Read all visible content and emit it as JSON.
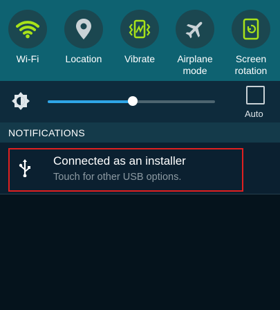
{
  "quick_settings": [
    {
      "label": "Wi-Fi",
      "icon": "wifi-icon",
      "active": true
    },
    {
      "label": "Location",
      "icon": "location-icon",
      "active": false
    },
    {
      "label": "Vibrate",
      "icon": "vibrate-icon",
      "active": true
    },
    {
      "label": "Airplane\nmode",
      "icon": "airplane-icon",
      "active": false
    },
    {
      "label": "Screen\nrotation",
      "icon": "screen-rotation-icon",
      "active": true
    }
  ],
  "brightness": {
    "level": 0.51,
    "auto_label": "Auto",
    "auto_checked": false
  },
  "notifications": {
    "header": "NOTIFICATIONS",
    "items": [
      {
        "title": "Connected as an installer",
        "subtitle": "Touch for other USB options.",
        "icon": "usb-icon"
      }
    ]
  },
  "colors": {
    "active_icon": "#a8e21a",
    "inactive_icon": "#c9d2d6",
    "slider_fill": "#2fa6e7",
    "panel_bg": "#0e6271",
    "highlight_border": "#e02020"
  }
}
